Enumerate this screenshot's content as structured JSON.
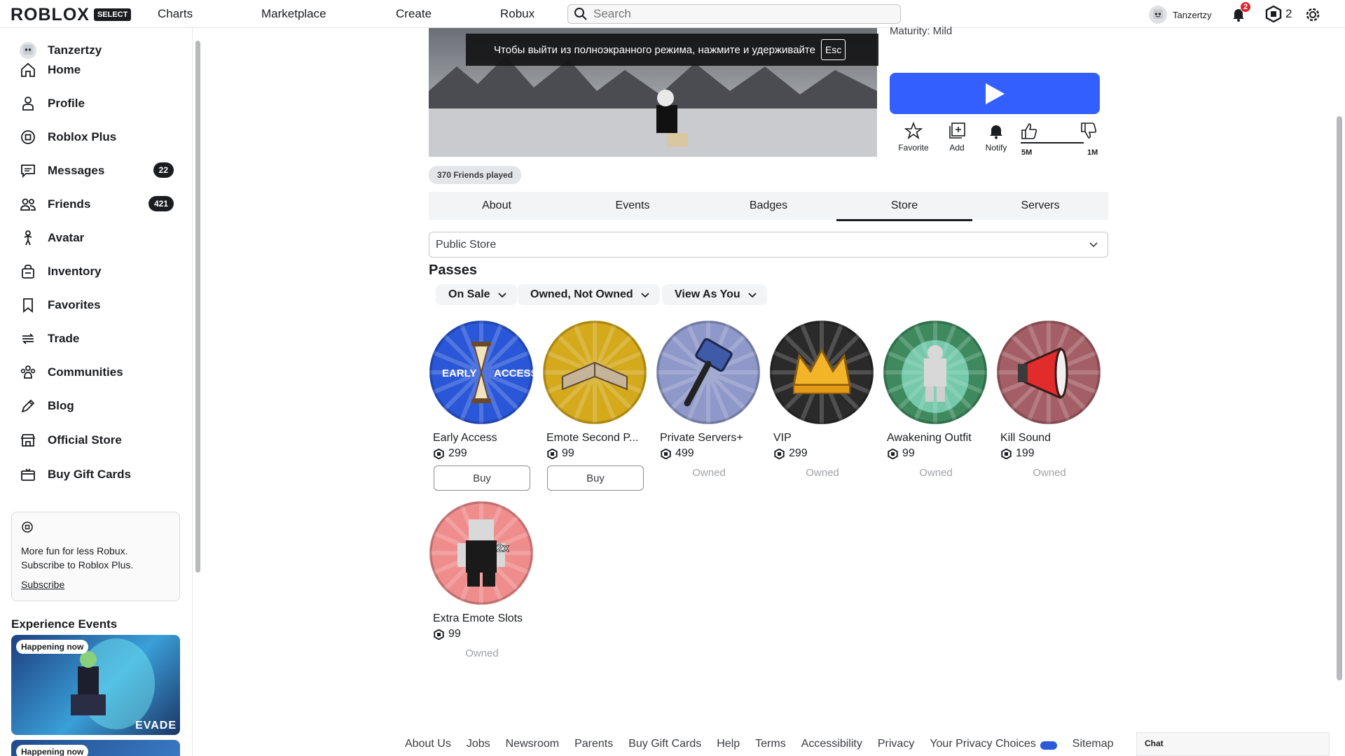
{
  "header": {
    "logo": "ROBLOX",
    "logo_badge": "SELECT",
    "nav": [
      "Charts",
      "Marketplace",
      "Create",
      "Robux"
    ],
    "search_placeholder": "Search",
    "username": "Tanzertzy",
    "notifications": "2",
    "robux": "2"
  },
  "sidebar": {
    "user": "Tanzertzy",
    "items": [
      {
        "label": "Home",
        "icon": "home-icon"
      },
      {
        "label": "Profile",
        "icon": "profile-icon"
      },
      {
        "label": "Roblox Plus",
        "icon": "roblox-plus-icon"
      },
      {
        "label": "Messages",
        "icon": "messages-icon",
        "count": "22"
      },
      {
        "label": "Friends",
        "icon": "friends-icon",
        "count": "421"
      },
      {
        "label": "Avatar",
        "icon": "avatar-icon"
      },
      {
        "label": "Inventory",
        "icon": "inventory-icon"
      },
      {
        "label": "Favorites",
        "icon": "bookmark-icon"
      },
      {
        "label": "Trade",
        "icon": "trade-icon"
      },
      {
        "label": "Communities",
        "icon": "communities-icon"
      },
      {
        "label": "Blog",
        "icon": "blog-icon"
      },
      {
        "label": "Official Store",
        "icon": "store-icon"
      },
      {
        "label": "Buy Gift Cards",
        "icon": "gift-card-icon"
      }
    ],
    "plus_card": {
      "text": "More fun for less Robux. Subscribe to Roblox Plus.",
      "link": "Subscribe"
    },
    "events_title": "Experience Events",
    "event_tag": "Happening now",
    "event_logo": "EVADE"
  },
  "game": {
    "fullscreen_notice": "Чтобы выйти из полноэкранного режима, нажмите и удерживайте",
    "esc": "Esc",
    "maturity": "Maturity: Mild",
    "actions": [
      "Favorite",
      "Add",
      "Notify"
    ],
    "likes": "5M",
    "dislikes": "1M",
    "friends_played": "370 Friends played"
  },
  "tabs": [
    "About",
    "Events",
    "Badges",
    "Store",
    "Servers"
  ],
  "active_tab": "Store",
  "store": {
    "selector": "Public Store",
    "section": "Passes",
    "filters": [
      "On Sale",
      "Owned, Not Owned",
      "View As You"
    ],
    "buy_label": "Buy",
    "owned_label": "Owned",
    "passes": [
      {
        "name": "Early Access",
        "price": "299",
        "status": "buy",
        "color": "#2a57d8"
      },
      {
        "name": "Emote Second P...",
        "price": "99",
        "status": "buy",
        "color": "#d4a91c"
      },
      {
        "name": "Private Servers+",
        "price": "499",
        "status": "owned",
        "color": "#8e98c9"
      },
      {
        "name": "VIP",
        "price": "299",
        "status": "owned",
        "color": "#2a2a2a"
      },
      {
        "name": "Awakening Outfit",
        "price": "99",
        "status": "owned",
        "color": "#3e8a5e"
      },
      {
        "name": "Kill Sound",
        "price": "199",
        "status": "owned",
        "color": "#a45e66"
      },
      {
        "name": "Extra Emote Slots",
        "price": "99",
        "status": "owned",
        "color": "#ef8d8d"
      }
    ]
  },
  "footer": [
    "About Us",
    "Jobs",
    "Newsroom",
    "Parents",
    "Buy Gift Cards",
    "Help",
    "Terms",
    "Accessibility",
    "Privacy",
    "Your Privacy Choices",
    "Sitemap"
  ],
  "chat": "Chat"
}
